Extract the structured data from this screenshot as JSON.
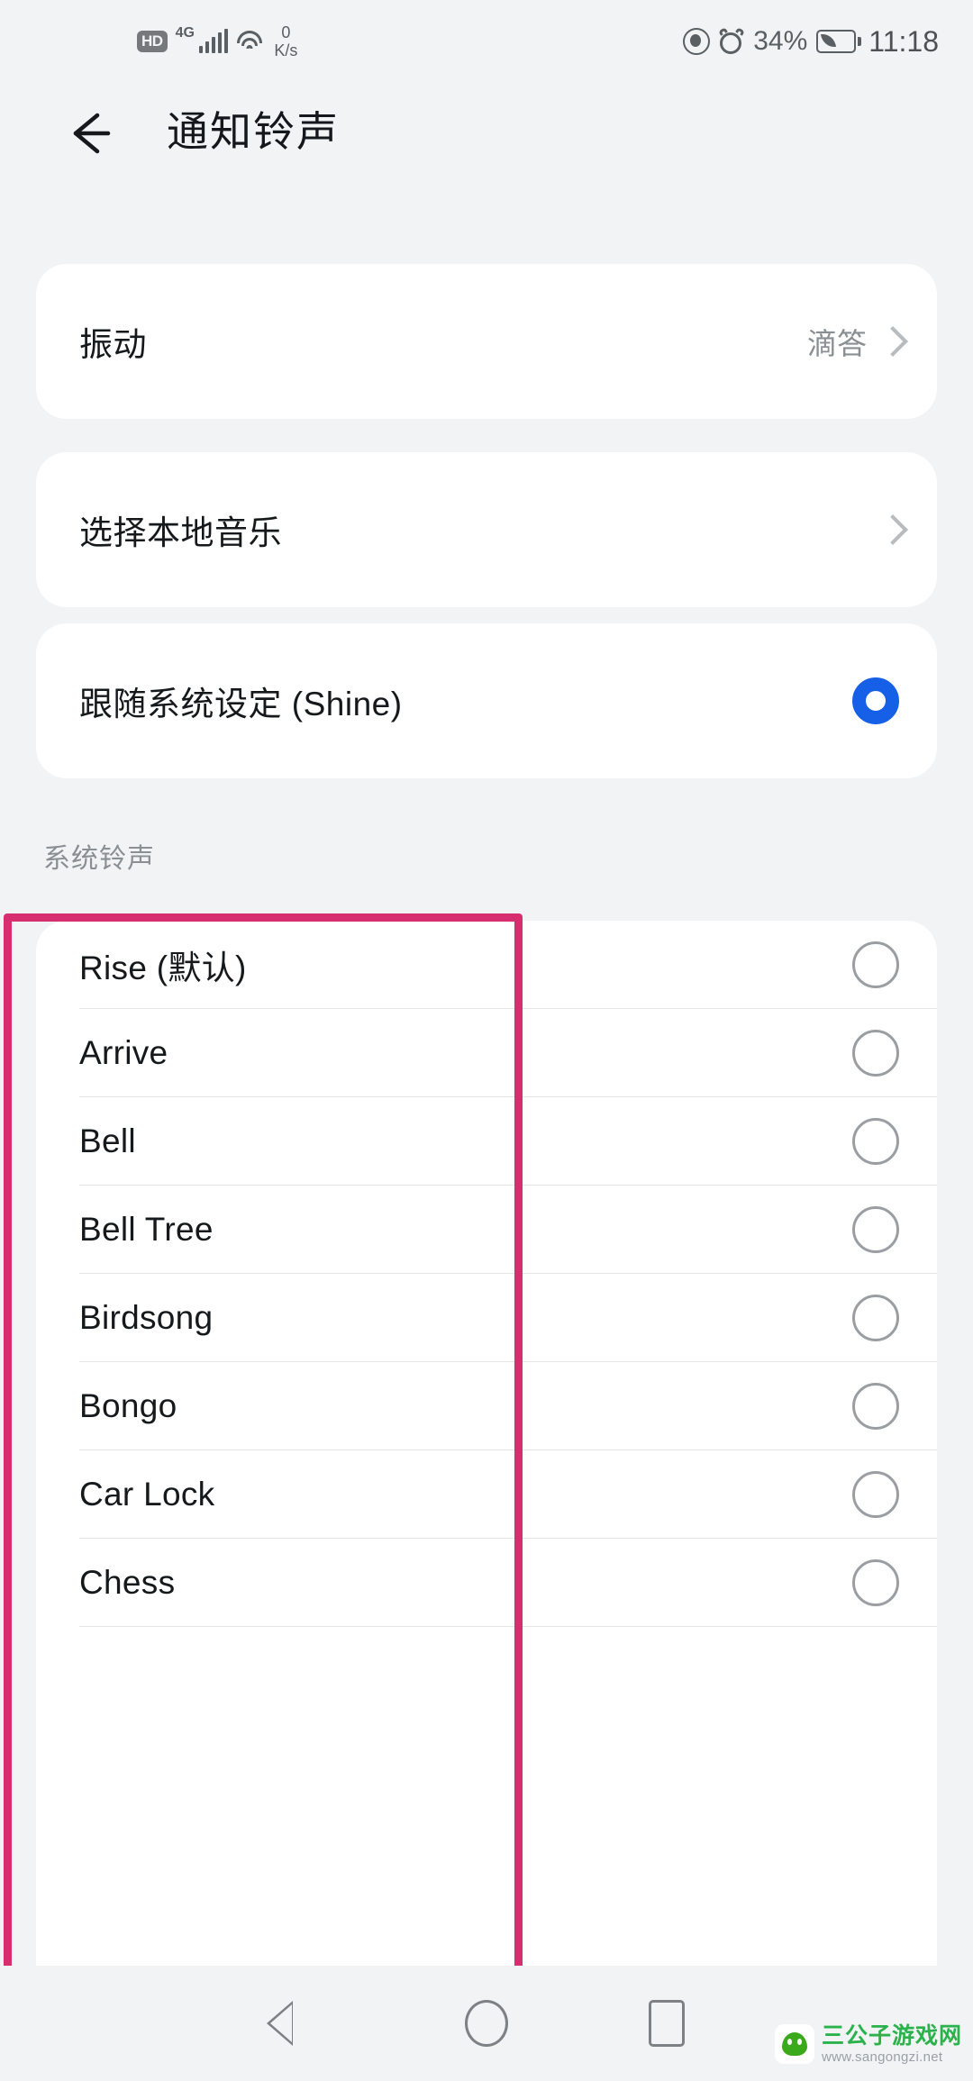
{
  "status_bar": {
    "hd_badge": "HD",
    "network_type": "4G",
    "signal_icon": "signal-bars-icon",
    "wifi_icon": "wifi-icon",
    "net_speed_value": "0",
    "net_speed_unit": "K/s",
    "eye_comfort_icon": "eye-icon",
    "alarm_icon": "alarm-clock-icon",
    "battery_percent": "34%",
    "battery_icon": "battery-power-saving-icon",
    "time": "11:18"
  },
  "app_bar": {
    "back_icon": "back-arrow-icon",
    "title": "通知铃声"
  },
  "cards": {
    "vibration": {
      "label": "振动",
      "value": "滴答",
      "chevron_icon": "chevron-right-icon"
    },
    "local_music": {
      "label": "选择本地音乐",
      "chevron_icon": "chevron-right-icon"
    },
    "follow_system": {
      "label": "跟随系统设定 (Shine)",
      "selected": true,
      "radio_icon": "radio-selected-icon"
    }
  },
  "section": {
    "title": "系统铃声"
  },
  "ringtones": [
    {
      "label": "Rise (默认)",
      "selected": false
    },
    {
      "label": "Arrive",
      "selected": false
    },
    {
      "label": "Bell",
      "selected": false
    },
    {
      "label": "Bell Tree",
      "selected": false
    },
    {
      "label": "Birdsong",
      "selected": false
    },
    {
      "label": "Bongo",
      "selected": false
    },
    {
      "label": "Car Lock",
      "selected": false
    },
    {
      "label": "Chess",
      "selected": false
    }
  ],
  "nav_bar": {
    "back_icon": "nav-back-triangle-icon",
    "home_icon": "nav-home-circle-icon",
    "recents_icon": "nav-recents-square-icon"
  },
  "annotation": {
    "color": "#d62e6e"
  },
  "watermark": {
    "logo_icon": "panda-logo-icon",
    "site_name": "三公子游戏网",
    "site_url": "www.sangongzi.net"
  },
  "colors": {
    "page_background": "#f1f3f4",
    "card_background": "#ffffff",
    "accent_blue": "#1660e8",
    "annotation_pink": "#d62e6e",
    "primary_text": "#16191c",
    "secondary_text": "#8a8f94"
  }
}
